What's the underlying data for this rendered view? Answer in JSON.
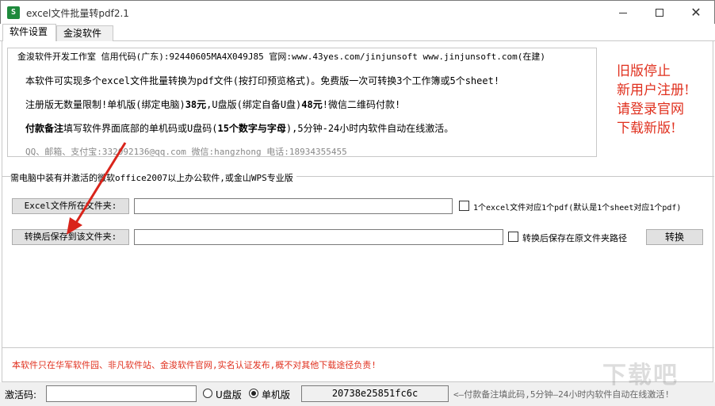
{
  "window": {
    "icon_text": "S",
    "title": "excel文件批量转pdf2.1"
  },
  "tabs": [
    {
      "label": "软件设置",
      "active": true
    },
    {
      "label": "金浚软件",
      "active": false
    }
  ],
  "info": {
    "legend": "金浚软件开发工作室 信用代码(广东):92440605MA4X049J85 官网:www.43yes.com/jinjunsoft  www.jinjunsoft.com(在建)",
    "line1": "本软件可实现多个excel文件批量转换为pdf文件(按打印预览格式)。免费版一次可转换3个工作簿或5个sheet!",
    "line2_a": "注册版无数量限制!单机版(绑定电脑)",
    "line2_b": "38元",
    "line2_c": ",U盘版(绑定自备U盘)",
    "line2_d": "48元",
    "line2_e": "!微信二维码付款!",
    "line3_a": "付款备注",
    "line3_b": "填写软件界面底部的单机码或U盘码(",
    "line3_c": "15个数字与字母",
    "line3_d": "),5分钟-24小时内软件自动在线激活。",
    "line4": "QQ、邮箱、支付宝:332092136@qq.com  微信:hangzhong  电话:18934355455"
  },
  "notice": {
    "line1": "旧版停止",
    "line2": "新用户注册!",
    "line3": "请登录官网",
    "line4": "下载新版!"
  },
  "requirement": "需电脑中装有并激活的微软office2007以上办公软件,或金山WPS专业版",
  "form": {
    "excel_folder_button": "Excel文件所在文件夹:",
    "excel_folder_value": "",
    "save_folder_button": "转换后保存到该文件夹:",
    "save_folder_value": "",
    "check1_label": "1个excel文件对应1个pdf(默认是1个sheet对应1个pdf)",
    "check2_label": "转换后保存在原文件夹路径",
    "convert_button": "转换"
  },
  "disclaimer": "本软件只在华军软件园、非凡软件站、金浚软件官网,实名认证发布,概不对其他下载途径负责!",
  "status": {
    "activation_label": "激活码:",
    "activation_value": "",
    "radio_u_label": "U盘版",
    "radio_single_label": "单机版",
    "machine_code": "20738e25851fc6c",
    "hint": "<—付款备注填此码,5分钟—24小时内软件自动在线激活!"
  },
  "watermark": "下载吧",
  "colors": {
    "accent_red": "#e0301e",
    "arrow_red": "#d9241b"
  }
}
